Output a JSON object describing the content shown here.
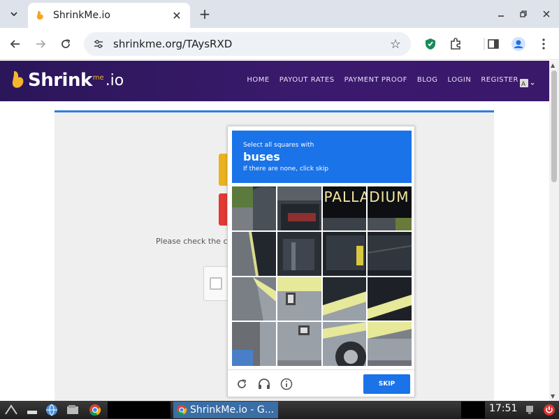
{
  "browser": {
    "tab_title": "ShrinkMe.io",
    "url": "shrinkme.org/TAysRXD",
    "close_glyph": "✕",
    "newtab_glyph": "+"
  },
  "site": {
    "logo_text": "Shrink",
    "logo_me": "me",
    "logo_io": ".io",
    "nav": [
      "HOME",
      "PAYOUT RATES",
      "PAYMENT PROOF",
      "BLOG",
      "LOGIN",
      "REGISTER"
    ],
    "please_text": "Please check the ca"
  },
  "captcha": {
    "instruction_small": "Select all squares with",
    "target": "buses",
    "instruction_sub": "If there are none, click skip",
    "sign_text": "PALLADIUM",
    "skip_label": "SKIP"
  },
  "taskbar": {
    "task_label": "ShrinkMe.io - G...",
    "clock": "17:51"
  },
  "colors": {
    "accent_blue": "#1a73e8",
    "site_header": "#2b1659"
  }
}
